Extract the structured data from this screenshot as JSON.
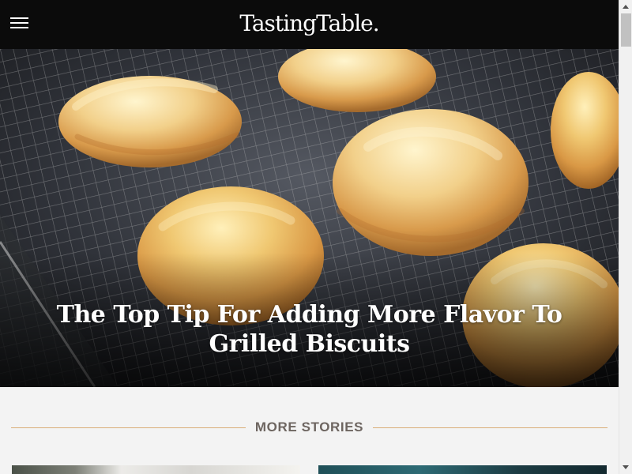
{
  "header": {
    "logo_text": "TastingTable."
  },
  "hero": {
    "title": "The Top Tip For Adding More Flavor To Grilled Biscuits"
  },
  "section": {
    "more_stories_label": "MORE STORIES"
  },
  "icons": {
    "menu": "menu-icon",
    "scroll_up": "scroll-up-icon",
    "scroll_down": "scroll-down-icon"
  },
  "colors": {
    "header_background": "#0b0b0b",
    "page_background": "#f3f3f3",
    "accent_rule": "#d9ad78",
    "section_label": "#6d6560",
    "title_text": "#ffffff"
  }
}
